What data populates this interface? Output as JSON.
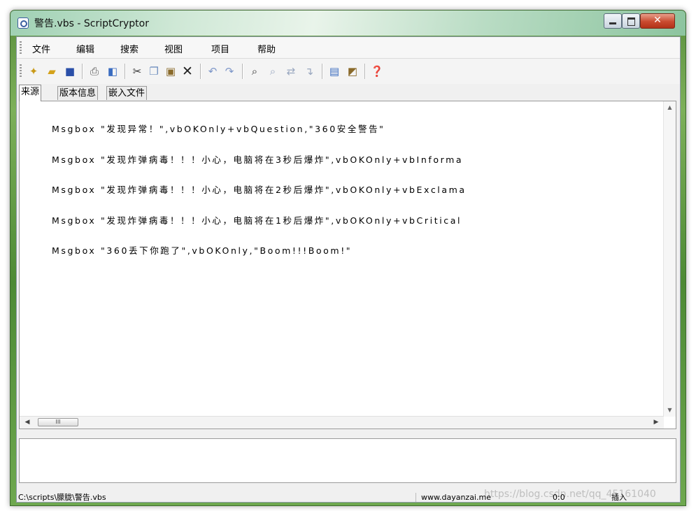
{
  "window": {
    "title": "警告.vbs - ScriptCryptor"
  },
  "menu": {
    "items": [
      "文件",
      "编辑",
      "搜索",
      "视图",
      "项目",
      "帮助"
    ]
  },
  "toolbar": {
    "icons": [
      "new-file-icon",
      "open-folder-icon",
      "save-icon",
      "print-icon",
      "print-preview-icon",
      "cut-icon",
      "copy-icon",
      "paste-icon",
      "delete-icon",
      "undo-icon",
      "redo-icon",
      "find-icon",
      "find-next-icon",
      "replace-icon",
      "goto-icon",
      "compile-icon",
      "properties-icon",
      "help-icon"
    ]
  },
  "tabs": [
    "来源",
    "版本信息",
    "嵌入文件"
  ],
  "editor": {
    "lines": [
      "Msgbox \"发现异常！\",vbOKOnly+vbQuestion,\"360安全警告\"",
      "Msgbox \"发现炸弹病毒！！！小心，电脑将在3秒后爆炸\",vbOKOnly+vbInforma",
      "Msgbox \"发现炸弹病毒！！！小心，电脑将在2秒后爆炸\",vbOKOnly+vbExclama",
      "Msgbox \"发现炸弹病毒！！！小心，电脑将在1秒后爆炸\",vbOKOnly+vbCritical",
      "Msgbox \"360丢下你跑了\",vbOKOnly,\"Boom!!!Boom!\""
    ],
    "hscroll_thumb": "III"
  },
  "status": {
    "path": "C:\\scripts\\朦胧\\警告.vbs",
    "website": "www.dayanzai.me",
    "position": "0:0",
    "mode": "插入",
    "watermark": "https://blog.csdn.net/qq_45161040"
  }
}
